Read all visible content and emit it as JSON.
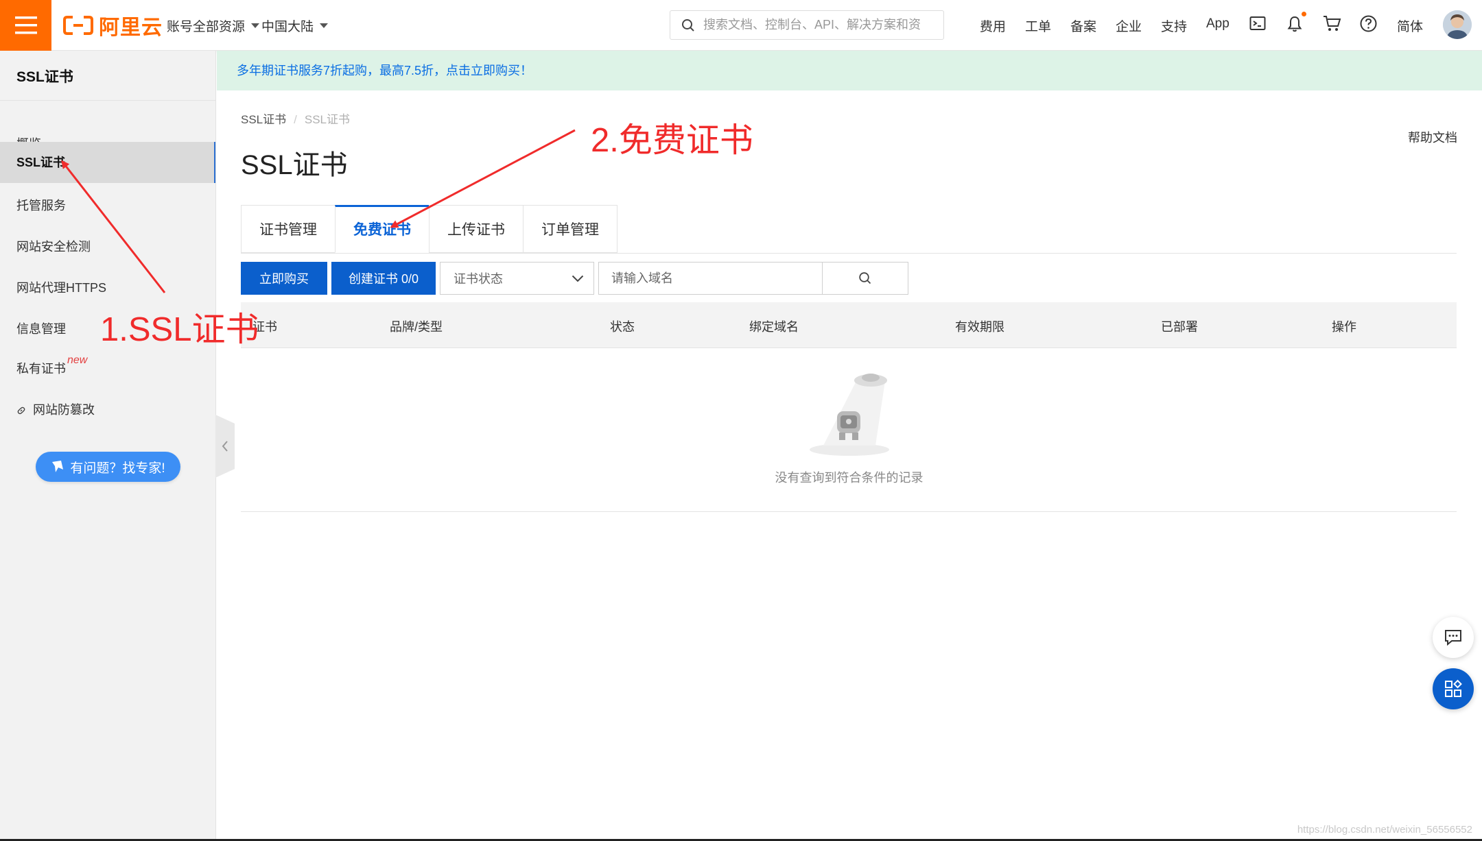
{
  "header": {
    "logo_text": "阿里云",
    "account_label": "账号全部资源",
    "region_label": "中国大陆",
    "search_placeholder": "搜索文档、控制台、API、解决方案和资",
    "nav": [
      "费用",
      "工单",
      "备案",
      "企业",
      "支持",
      "App"
    ],
    "lang_label": "简体"
  },
  "sidebar": {
    "title": "SSL证书",
    "items": [
      {
        "label": "概览"
      },
      {
        "label": "SSL证书"
      },
      {
        "label": "托管服务"
      },
      {
        "label": "网站安全检测"
      },
      {
        "label": "网站代理HTTPS"
      },
      {
        "label": "信息管理"
      },
      {
        "label": "私有证书",
        "tag": "new"
      },
      {
        "label": "网站防篡改"
      }
    ],
    "expert_button": "有问题？找专家!"
  },
  "banner": {
    "text": "多年期证书服务7折起购，最高7.5折，点击立即购买！"
  },
  "page": {
    "breadcrumb": [
      "SSL证书",
      "SSL证书"
    ],
    "title": "SSL证书",
    "help_link": "帮助文档",
    "tabs": [
      "证书管理",
      "免费证书",
      "上传证书",
      "订单管理"
    ],
    "active_tab": "免费证书",
    "buy_button": "立即购买",
    "create_button": "创建证书 0/0",
    "status_select": "证书状态",
    "domain_placeholder": "请输入域名",
    "table": {
      "columns": [
        "证书",
        "品牌/类型",
        "状态",
        "绑定域名",
        "有效期限",
        "已部署",
        "操作"
      ],
      "rows": [],
      "empty_text": "没有查询到符合条件的记录"
    }
  },
  "annotations": {
    "step1": "1.SSL证书",
    "step2": "2.免费证书",
    "color": "#f02b2b"
  },
  "colors": {
    "brand": "#ff6a00",
    "primary": "#0b5fcc",
    "banner_bg": "#ddf3e7"
  },
  "watermark": "https://blog.csdn.net/weixin_56556552"
}
